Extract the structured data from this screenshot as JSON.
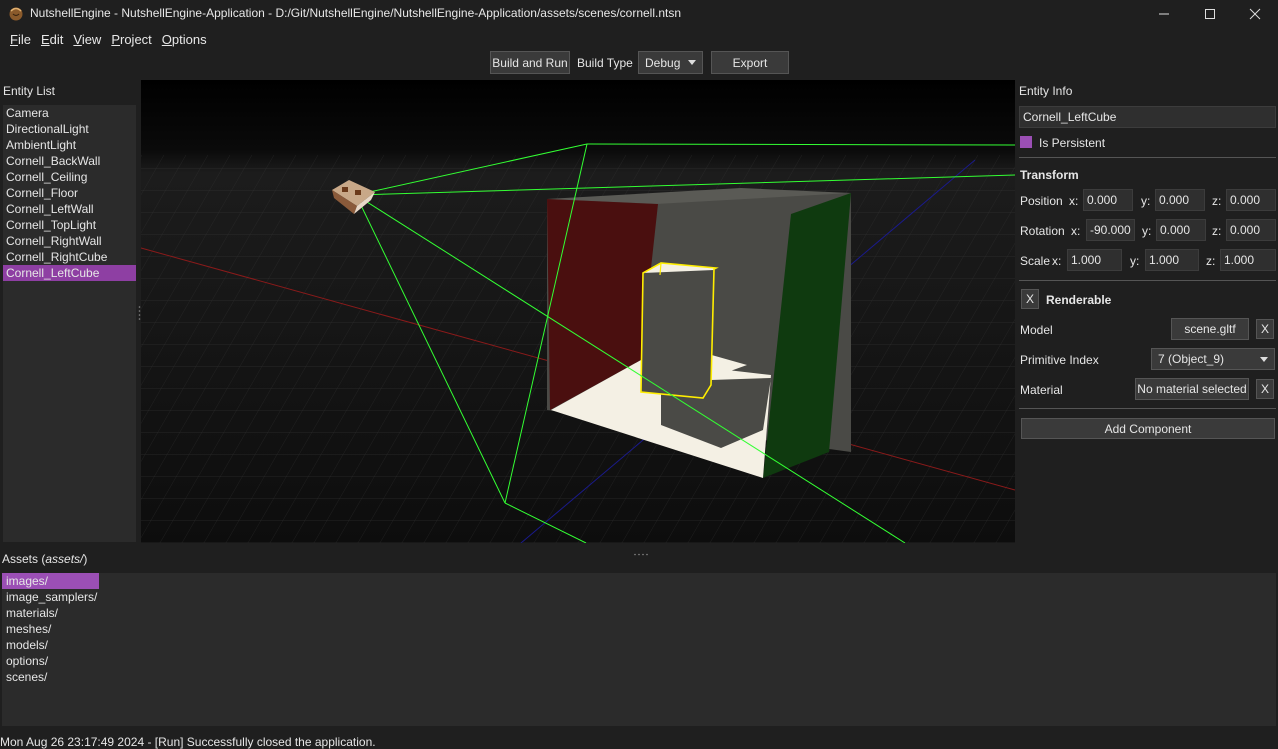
{
  "window": {
    "title": "NutshellEngine - NutshellEngine-Application - D:/Git/NutshellEngine/NutshellEngine-Application/assets/scenes/cornell.ntsn"
  },
  "menu": [
    {
      "label": "File",
      "underline": "F",
      "rest": "ile"
    },
    {
      "label": "Edit",
      "underline": "E",
      "rest": "dit"
    },
    {
      "label": "View",
      "underline": "V",
      "rest": "iew"
    },
    {
      "label": "Project",
      "underline": "P",
      "rest": "roject"
    },
    {
      "label": "Options",
      "underline": "O",
      "rest": "ptions"
    }
  ],
  "toolbar": {
    "build_run": "Build and Run",
    "build_type_label": "Build Type",
    "build_type_value": "Debug",
    "export": "Export"
  },
  "entity_list": {
    "title": "Entity List",
    "items": [
      "Camera",
      "DirectionalLight",
      "AmbientLight",
      "Cornell_BackWall",
      "Cornell_Ceiling",
      "Cornell_Floor",
      "Cornell_LeftWall",
      "Cornell_TopLight",
      "Cornell_RightWall",
      "Cornell_RightCube",
      "Cornell_LeftCube"
    ],
    "selected_index": 10
  },
  "entity_info": {
    "title": "Entity Info",
    "name": "Cornell_LeftCube",
    "is_persistent_label": "Is Persistent",
    "transform": {
      "title": "Transform",
      "position_label": "Position",
      "rotation_label": "Rotation",
      "scale_label": "Scale",
      "x_label": "x:",
      "y_label": "y:",
      "z_label": "z:",
      "position": {
        "x": "0.000",
        "y": "0.000",
        "z": "0.000"
      },
      "rotation": {
        "x": "-90.000",
        "y": "0.000",
        "z": "0.000"
      },
      "scale": {
        "x": "1.000",
        "y": "1.000",
        "z": "1.000"
      }
    },
    "renderable": {
      "title": "Renderable",
      "remove_label": "X",
      "model_label": "Model",
      "model_value": "scene.gltf",
      "primitive_label": "Primitive Index",
      "primitive_value": "7 (Object_9)",
      "material_label": "Material",
      "material_value": "No material selected"
    },
    "add_component": "Add Component"
  },
  "assets": {
    "title_prefix": "Assets (",
    "title_dir": "assets/",
    "title_suffix": ")",
    "items": [
      "images/",
      "image_samplers/",
      "materials/",
      "meshes/",
      "models/",
      "options/",
      "scenes/"
    ],
    "selected_index": 0
  },
  "status": "Mon Aug 26 23:17:49 2024 - [Run] Successfully closed the application.",
  "colors": {
    "selection": "#8e3fa3",
    "left_wall": "#4a0f0f",
    "right_wall": "#0f3a0f",
    "frustum": "#33ff33",
    "gizmo": "#ffee00"
  }
}
